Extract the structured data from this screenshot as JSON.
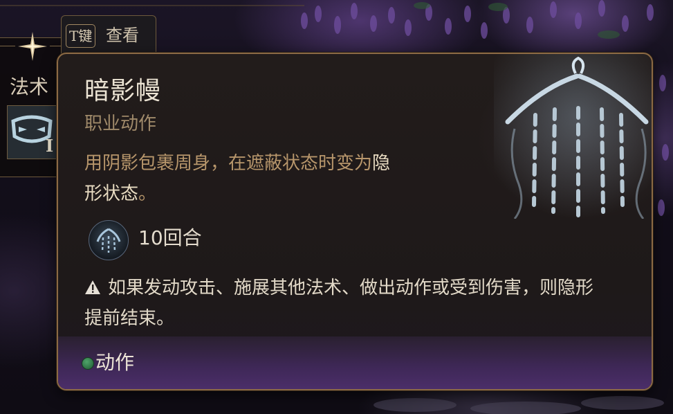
{
  "hotkey_hint": {
    "key": "T键",
    "label": "查看"
  },
  "spell_panel": {
    "label": "法术",
    "slot_level": "I"
  },
  "tooltip": {
    "name": "暗影幔",
    "type": "职业动作",
    "description_plain": "用阴影包裹周身，在遮蔽状态时变为",
    "description_highlight_1": "隐",
    "description_line2_highlight": "形状态",
    "description_end": "。",
    "duration": "10回合",
    "warning": "如果发动攻击、施展其他法术、做出动作或受到伤害，则隐形提前结束。",
    "action_cost": "动作"
  },
  "icons": [
    "sparkle-star-icon",
    "spell-mask-icon",
    "shadow-veil-art",
    "duration-veil-icon",
    "warning-icon",
    "action-dot-icon"
  ],
  "colors": {
    "border_gold": "#8c6a45",
    "description_tan": "#b7966b",
    "footer_purple": "#4b2e69",
    "action_green": "#3a8a52"
  }
}
